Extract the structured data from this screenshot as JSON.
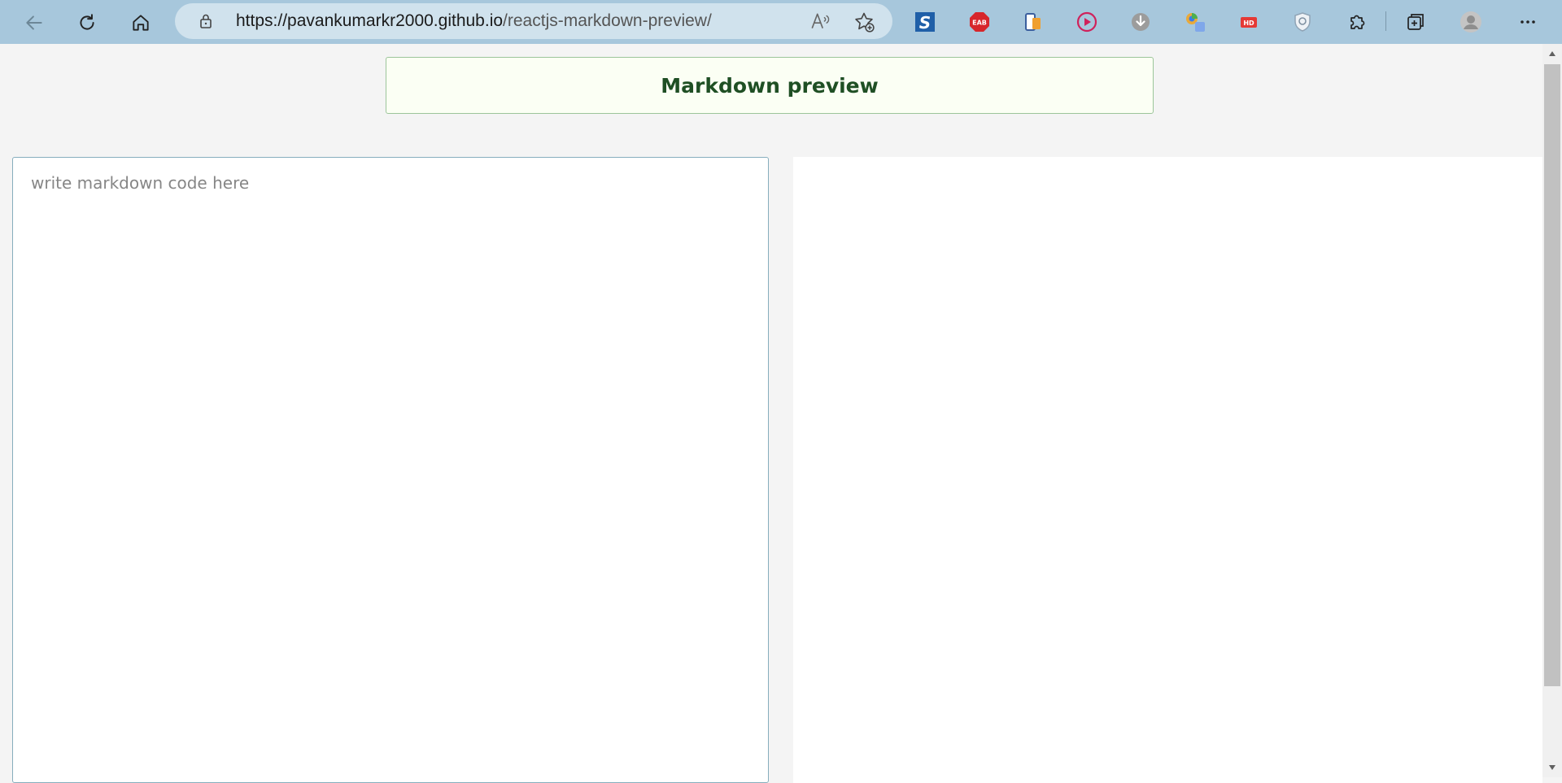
{
  "browser": {
    "url_host": "https://pavankumarkr2000.github.io",
    "url_path": "/reactjs-markdown-preview/",
    "toolbar_color": "#a7c7dc",
    "icons": [
      "back-icon",
      "refresh-icon",
      "home-icon",
      "lock-icon",
      "read-aloud-icon",
      "add-favorite-icon"
    ],
    "extensions": [
      "s-extension-icon",
      "eab-extension-icon",
      "phone-extension-icon",
      "play-extension-icon",
      "download-extension-icon",
      "puzzle-colorful-extension-icon",
      "hd-extension-icon",
      "shield-extension-icon",
      "extensions-icon",
      "collections-icon",
      "profile-avatar",
      "more-menu-icon"
    ],
    "eab_label": "EAB",
    "hd_label": "HD",
    "s_label": "S"
  },
  "page": {
    "title": "Markdown preview",
    "editor_placeholder": "write markdown code here",
    "editor_value": "",
    "header_border_color": "#9cc59a",
    "header_bg_color": "#fbfff4",
    "title_color": "#1f4f24"
  }
}
